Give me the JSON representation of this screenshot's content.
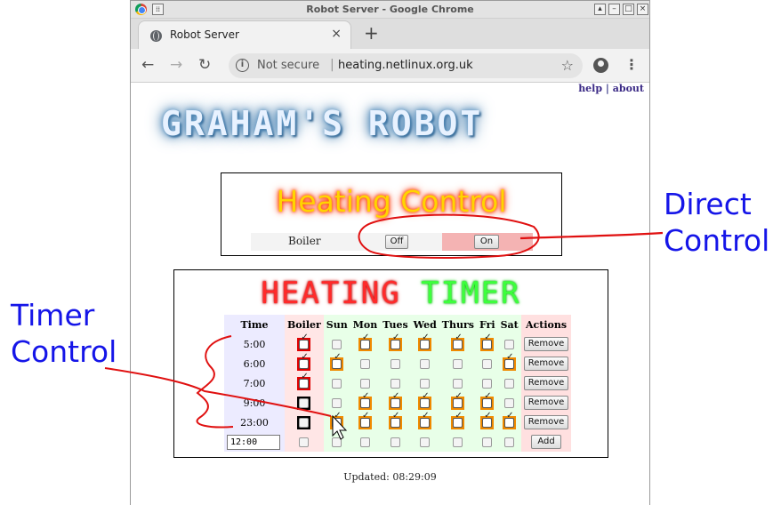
{
  "window": {
    "title": "Robot Server - Google Chrome"
  },
  "tab": {
    "label": "Robot Server",
    "close": "×",
    "new": "+"
  },
  "address": {
    "security": "Not secure",
    "url": "heating.netlinux.org.uk"
  },
  "toplinks": {
    "help": "help",
    "sep": "|",
    "about": "about"
  },
  "banner": {
    "text": "GRAHAM'S ROBOT"
  },
  "heating_control": {
    "title": "Heating Control",
    "row_label": "Boiler",
    "off_label": "Off",
    "on_label": "On"
  },
  "timer": {
    "title_part1": "HEATING",
    "title_part2": "TIMER",
    "headers": [
      "Time",
      "Boiler",
      "Sun",
      "Mon",
      "Tues",
      "Wed",
      "Thurs",
      "Fri",
      "Sat",
      "Actions"
    ],
    "rows": [
      {
        "time": "5:00",
        "boiler": true,
        "days": [
          false,
          true,
          true,
          true,
          true,
          true,
          false
        ],
        "action": "Remove"
      },
      {
        "time": "6:00",
        "boiler": true,
        "days": [
          true,
          false,
          false,
          false,
          false,
          false,
          true
        ],
        "action": "Remove"
      },
      {
        "time": "7:00",
        "boiler": true,
        "days": [
          false,
          false,
          false,
          false,
          false,
          false,
          false
        ],
        "action": "Remove"
      },
      {
        "time": "9:00",
        "boiler": false,
        "days": [
          false,
          true,
          true,
          true,
          true,
          true,
          false
        ],
        "action": "Remove"
      },
      {
        "time": "23:00",
        "boiler": false,
        "days": [
          true,
          true,
          true,
          true,
          true,
          true,
          true
        ],
        "action": "Remove"
      }
    ],
    "new_row": {
      "time_value": "12:00",
      "action": "Add"
    }
  },
  "status": {
    "updated": "Updated: 08:29:09"
  },
  "annotations": {
    "direct_line1": "Direct",
    "direct_line2": "Control",
    "timer_line1": "Timer",
    "timer_line2": "Control"
  },
  "colors": {
    "annotation_blue": "#1515e8",
    "annotation_red": "#e01010",
    "day_checked": "#f08a00",
    "boiler_checked": "#e00000"
  }
}
